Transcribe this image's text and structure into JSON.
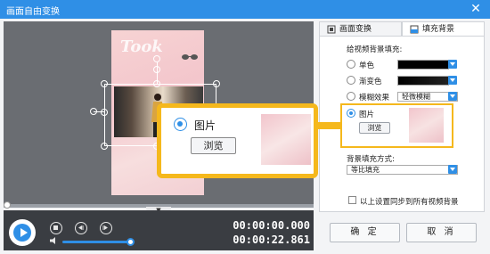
{
  "window": {
    "title": "画面自由变换",
    "close_icon": "close-icon"
  },
  "preview": {
    "poster_text": "Took",
    "time_current": "00:00:00.000",
    "time_total": "00:00:22.861"
  },
  "tabs": [
    {
      "label": "画面变换",
      "icon": "transform-icon",
      "active": false
    },
    {
      "label": "填充背景",
      "icon": "fill-background-icon",
      "active": true
    }
  ],
  "panel": {
    "section_title": "给视频背景填充:",
    "options": {
      "solid": {
        "label": "单色",
        "color": "#000000"
      },
      "gradient": {
        "label": "渐变色",
        "color": "#000000"
      },
      "blur": {
        "label": "模糊效果",
        "value": "轻微模糊"
      },
      "image": {
        "label": "图片",
        "browse_label": "浏览",
        "selected": true
      }
    },
    "fill_mode_title": "背景填充方式:",
    "fill_mode_value": "等比填充",
    "sync_label": "以上设置同步到所有视频背景",
    "sync_checked": false
  },
  "callout": {
    "label": "图片",
    "browse_label": "浏览"
  },
  "footer": {
    "ok_label": "确 定",
    "cancel_label": "取 消"
  },
  "colors": {
    "accent": "#2f8fe6",
    "highlight": "#f5b81c",
    "title_bar": "#2f8fe6"
  }
}
